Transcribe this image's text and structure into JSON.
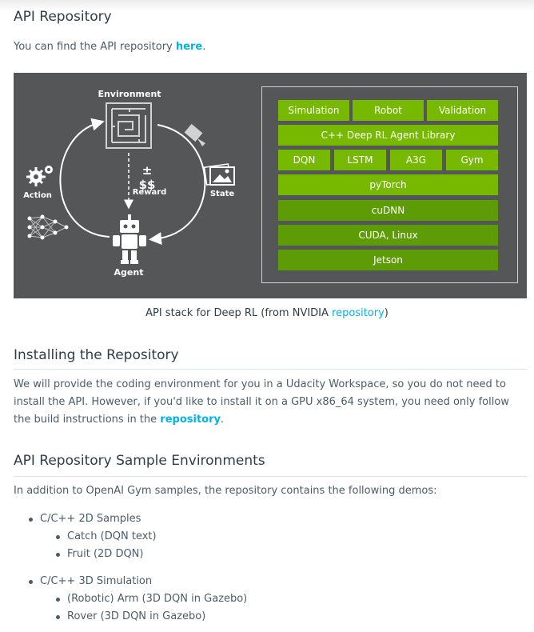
{
  "section1": {
    "title": "API Repository",
    "intro_prefix": "You can find the API repository ",
    "intro_link": "here",
    "intro_suffix": "."
  },
  "diagram": {
    "environment_label": "Environment",
    "action_label": "Action",
    "reward_label": "Reward",
    "state_label": "State",
    "agent_label": "Agent",
    "stack_rows": [
      [
        "Simulation",
        "Robot",
        "Validation"
      ],
      [
        "C++ Deep RL Agent Library"
      ],
      [
        "DQN",
        "LSTM",
        "A3G",
        "Gym"
      ],
      [
        "pyTorch"
      ],
      [
        "cuDNN"
      ],
      [
        "CUDA, Linux"
      ],
      [
        "Jetson"
      ]
    ],
    "colors": {
      "bright_green": "#76b900",
      "dark_green": "#5d9c06",
      "panel": "#545657"
    }
  },
  "caption": {
    "prefix": "API stack for Deep RL (from NVIDIA ",
    "link": "repository",
    "suffix": ")"
  },
  "section2": {
    "title": "Installing the Repository",
    "body_prefix": "We will provide the coding environment for you in a Udacity Workspace, so you do not need to install the API. However, if you'd like to install it on a GPU x86_64 system, you need only follow the build instructions in the ",
    "body_link": "repository",
    "body_suffix": "."
  },
  "section3": {
    "title": "API Repository Sample Environments",
    "intro": "In addition to OpenAI Gym samples, the repository contains the following demos:",
    "groups": [
      {
        "label": "C/C++ 2D Samples",
        "items": [
          "Catch (DQN text)",
          "Fruit (2D DQN)"
        ]
      },
      {
        "label": "C/C++ 3D Simulation",
        "items": [
          "(Robotic) Arm (3D DQN in Gazebo)",
          "Rover (3D DQN in Gazebo)"
        ]
      }
    ]
  },
  "accent_color": "#02b3e4"
}
